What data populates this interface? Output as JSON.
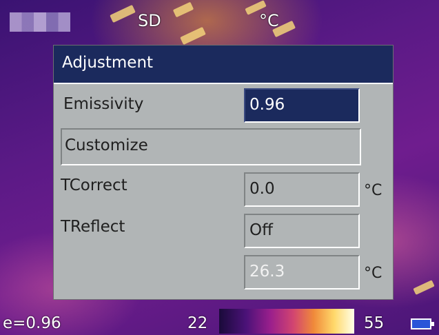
{
  "overlay": {
    "storage_label": "SD",
    "unit_label": "°C"
  },
  "dialog": {
    "title": "Adjustment",
    "emissivity_label": "Emissivity",
    "emissivity_value": "0.96",
    "customize_label": "Customize",
    "tcorrect_label": "TCorrect",
    "tcorrect_value": "0.0",
    "tcorrect_unit": "°C",
    "treflect_label": "TReflect",
    "treflect_value": "Off",
    "treflect_temp_value": "26.3",
    "treflect_temp_unit": "°C"
  },
  "status_bar": {
    "emissivity_text": "e=0.96",
    "range_min": "22",
    "range_max": "55",
    "palette_colors": [
      "#1a0a3a",
      "#4b1278",
      "#9a1f8c",
      "#d24570",
      "#f08a3a",
      "#ffd86a",
      "#ffffe8"
    ],
    "battery_icon": "battery-icon"
  },
  "colors": {
    "dialog_bg": "#b1b5b6",
    "title_bg": "#1b2a5d",
    "selected_field_bg": "#1b2a5d"
  }
}
